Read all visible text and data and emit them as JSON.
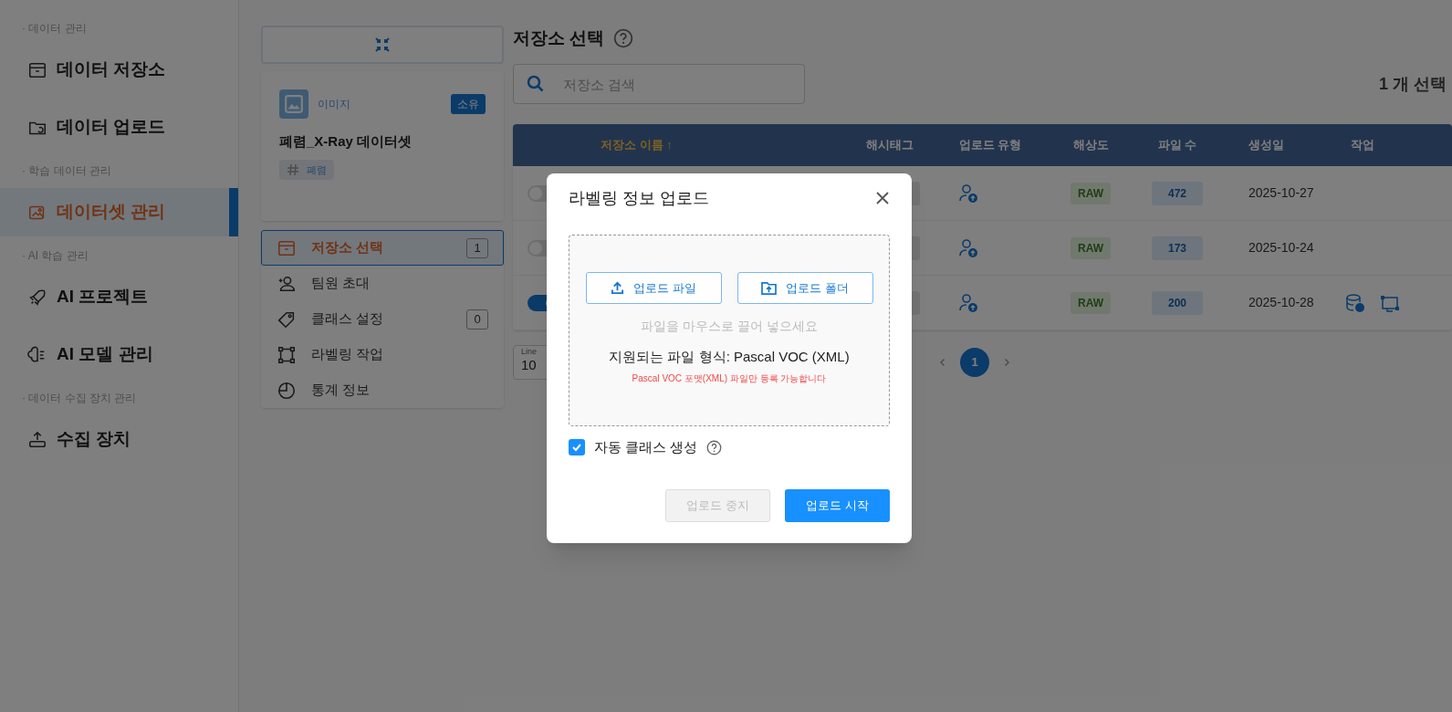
{
  "sidebar": {
    "sections": [
      {
        "label": "· 데이터 관리",
        "items": [
          {
            "label": "데이터 저장소",
            "selected": false
          },
          {
            "label": "데이터 업로드",
            "selected": false
          }
        ]
      },
      {
        "label": "· 학습 데이터 관리",
        "items": [
          {
            "label": "데이터셋 관리",
            "selected": true
          }
        ]
      },
      {
        "label": "· AI 학습 관리",
        "items": [
          {
            "label": "AI 프로젝트",
            "selected": false
          },
          {
            "label": "AI 모델 관리",
            "selected": false
          }
        ]
      },
      {
        "label": "· 데이터 수집 장치 관리",
        "items": [
          {
            "label": "수집 장치",
            "selected": false
          }
        ]
      }
    ]
  },
  "dataset_card": {
    "type": "이미지",
    "badge": "소유",
    "name": "폐렴_X-Ray 데이터셋",
    "tags": [
      "폐렴"
    ]
  },
  "steps": [
    {
      "label": "저장소 선택",
      "selected": true,
      "count": "1"
    },
    {
      "label": "팀원 초대",
      "selected": false
    },
    {
      "label": "클래스 설정",
      "selected": false,
      "count": "0"
    },
    {
      "label": "라벨링 작업",
      "selected": false
    },
    {
      "label": "통계 정보",
      "selected": false
    }
  ],
  "main": {
    "title": "저장소 선택",
    "search": {
      "placeholder": "저장소 검색"
    },
    "selection_count": "1 개 선택",
    "table": {
      "columns": [
        "저장소 이름 ↑",
        "해시태그",
        "업로드 유형",
        "해상도",
        "파일 수",
        "생성일",
        "작업"
      ],
      "rows": [
        {
          "on": false,
          "resolution": "RAW",
          "files": "472",
          "created": "2025-10-27",
          "actions": false
        },
        {
          "on": false,
          "resolution": "RAW",
          "files": "173",
          "created": "2025-10-24",
          "actions": false
        },
        {
          "on": true,
          "resolution": "RAW",
          "files": "200",
          "created": "2025-10-28",
          "actions": true
        }
      ]
    },
    "pagination": {
      "lines_label": "Line",
      "lines_value": "10",
      "pages": [
        {
          "label": "1",
          "selected": true
        }
      ]
    }
  },
  "dialog": {
    "title": "라벨링 정보 업로드",
    "buttons_upload": [
      "업로드 파일",
      "업로드 폴더"
    ],
    "hint": "파일을 마우스로 끌어 넣으세요",
    "formats": "지원되는 파일 형식: Pascal VOC (XML)",
    "warning": "Pascal VOC 포맷(XML) 파일만 등록 가능합니다",
    "auto_class": {
      "label": "자동 클래스 생성",
      "checked": true
    },
    "footer": [
      {
        "label": "업로드 중지",
        "disabled": true
      },
      {
        "label": "업로드 시작",
        "disabled": false
      }
    ]
  }
}
